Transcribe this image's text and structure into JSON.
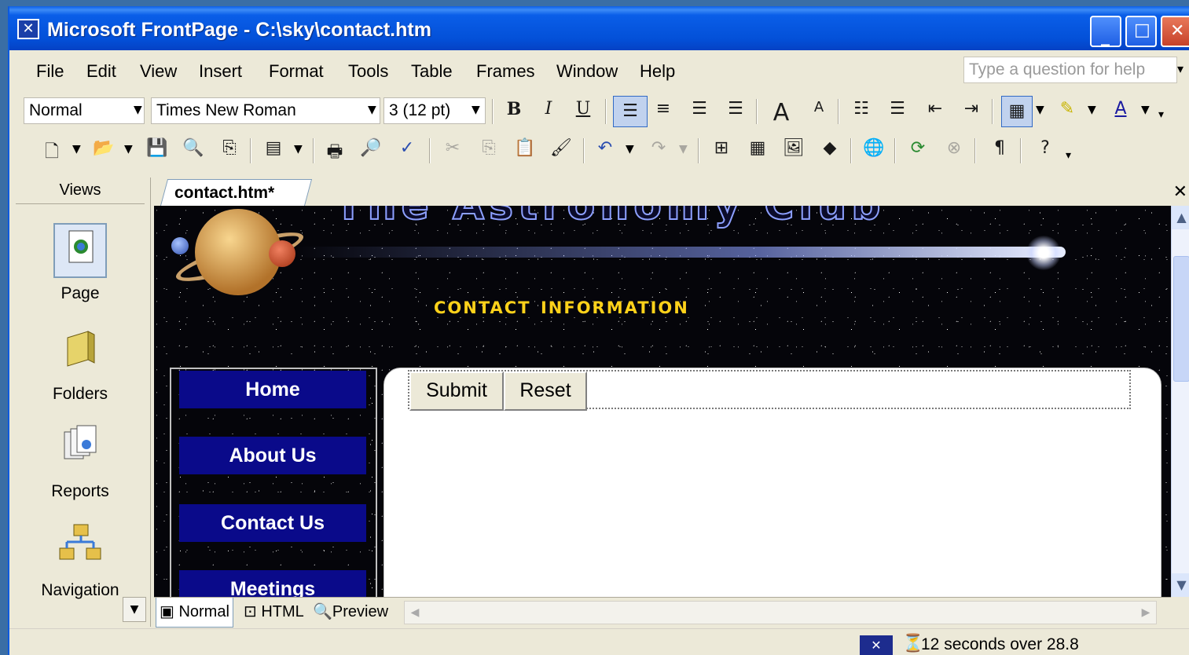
{
  "window": {
    "title": "Microsoft FrontPage - C:\\sky\\contact.htm"
  },
  "menubar": {
    "items": [
      "File",
      "Edit",
      "View",
      "Insert",
      "Format",
      "Tools",
      "Table",
      "Frames",
      "Window",
      "Help"
    ],
    "help_placeholder": "Type a question for help"
  },
  "formatting_toolbar": {
    "style": "Normal",
    "font": "Times New Roman",
    "size": "3  (12 pt)",
    "bold_label": "B",
    "italic_label": "I",
    "underline_label": "U"
  },
  "views_panel": {
    "header": "Views",
    "items": [
      {
        "label": "Page",
        "icon": "page-view-icon"
      },
      {
        "label": "Folders",
        "icon": "folders-icon"
      },
      {
        "label": "Reports",
        "icon": "reports-icon"
      },
      {
        "label": "Navigation",
        "icon": "navigation-icon"
      }
    ]
  },
  "document": {
    "tab_label": "contact.htm*",
    "heading": "contact information",
    "banner_title": "The Astronomy Club",
    "nav": [
      "Home",
      "About Us",
      "Contact Us",
      "Meetings"
    ],
    "form_buttons": {
      "submit": "Submit",
      "reset": "Reset"
    }
  },
  "view_tabs": {
    "normal": "Normal",
    "html": "HTML",
    "preview": "Preview"
  },
  "statusbar": {
    "download_time": "12 seconds over 28.8"
  },
  "colors": {
    "titlebar": "#0a5ee8",
    "nav_button": "#0a0a8a",
    "heading": "#ffd21a"
  }
}
